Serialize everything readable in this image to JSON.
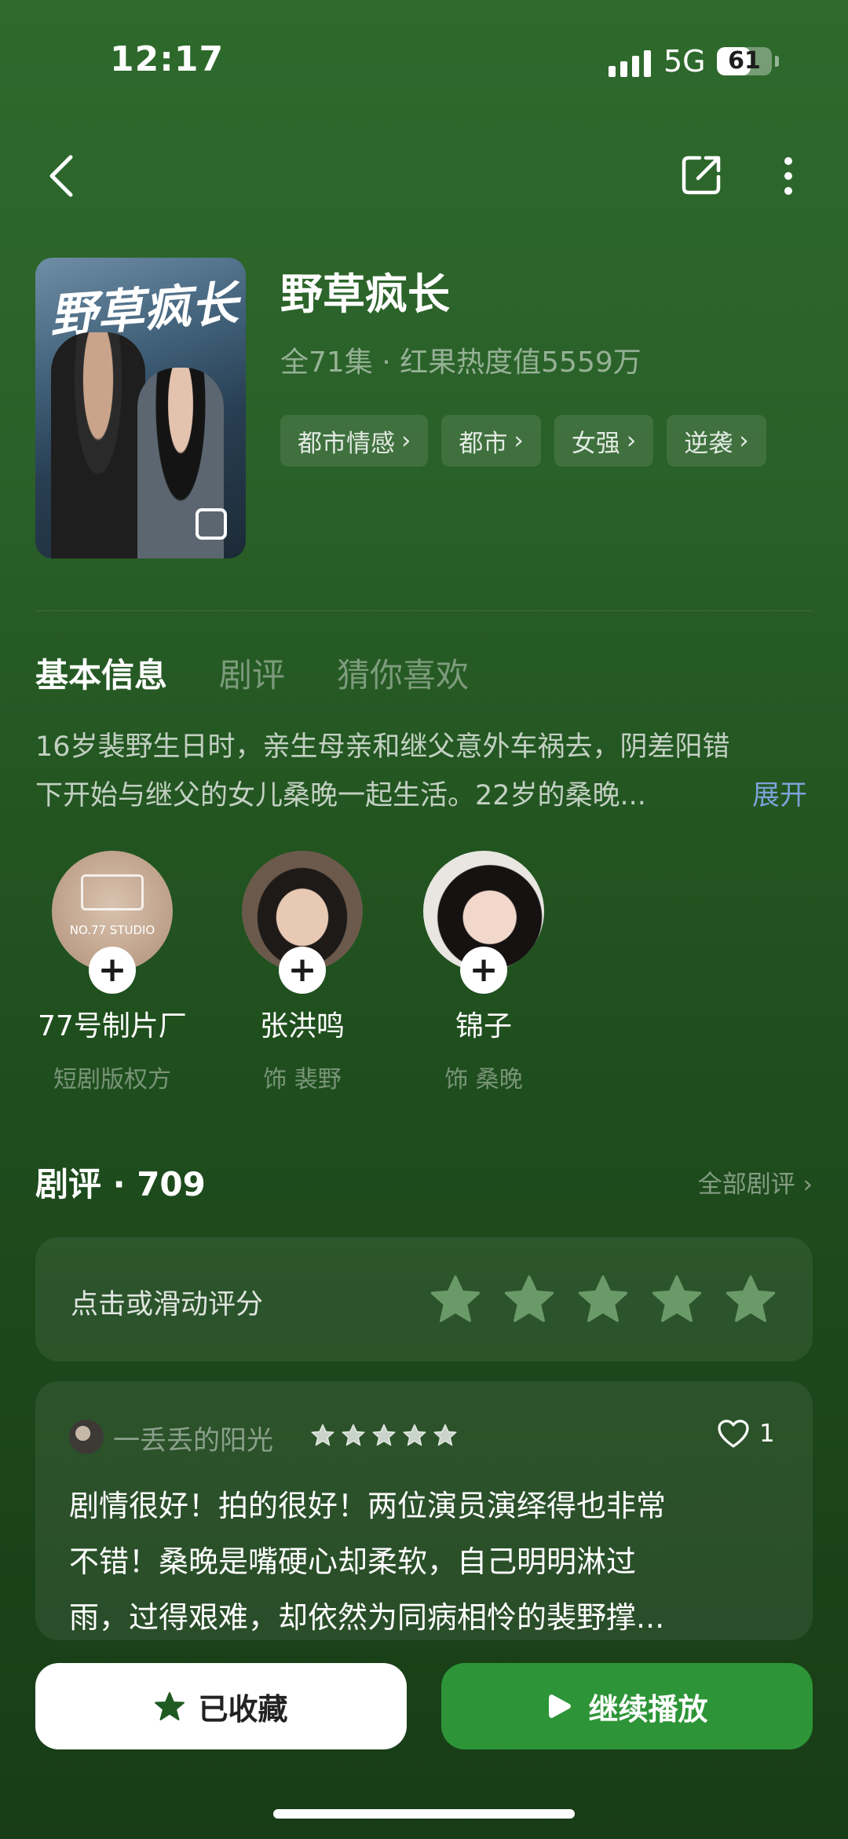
{
  "status_bar": {
    "time": "12:17",
    "network": "5G",
    "battery": "61",
    "battery_level": 0.61
  },
  "nav": {
    "back_icon": "chevron-left-icon",
    "share_icon": "share-icon",
    "more_icon": "more-vertical-icon"
  },
  "drama": {
    "title": "野草疯长",
    "meta": "全71集 · 红果热度值5559万",
    "poster_title": "野草疯长",
    "tags": [
      "都市情感",
      "都市",
      "女强",
      "逆袭"
    ]
  },
  "tabs": [
    {
      "label": "基本信息",
      "active": true
    },
    {
      "label": "剧评",
      "active": false
    },
    {
      "label": "猜你喜欢",
      "active": false
    }
  ],
  "synopsis": {
    "line1": "16岁裴野生日时，亲生母亲和继父意外车祸去，阴差阳错",
    "line2": "下开始与继父的女儿桑晚一起生活。22岁的桑晚...",
    "expand_label": "展开"
  },
  "cast": [
    {
      "name": "77号制片厂",
      "role": "短剧版权方",
      "avatar_text": "NO.77 STUDIO"
    },
    {
      "name": "张洪鸣",
      "role": "饰 裴野"
    },
    {
      "name": "锦子",
      "role": "饰 桑晚"
    }
  ],
  "reviews": {
    "header": "剧评 · 709",
    "all_label": "全部剧评 ›",
    "rate_prompt": "点击或滑动评分",
    "rating_stars": 5,
    "item": {
      "user": "一丢丢的阳光",
      "stars": 5,
      "likes": "1",
      "lines": [
        "剧情很好！拍的很好！两位演员演绎得也非常",
        "不错！桑晚是嘴硬心却柔软，自己明明淋过",
        "雨，过得艰难，却依然为同病相怜的裴野撑..."
      ]
    }
  },
  "actions": {
    "favorite_label": "已收藏",
    "play_label": "继续播放"
  },
  "colors": {
    "accent_green": "#2d9537",
    "link_blue": "#7ba3d8",
    "star_fill": "#6a9a68"
  }
}
